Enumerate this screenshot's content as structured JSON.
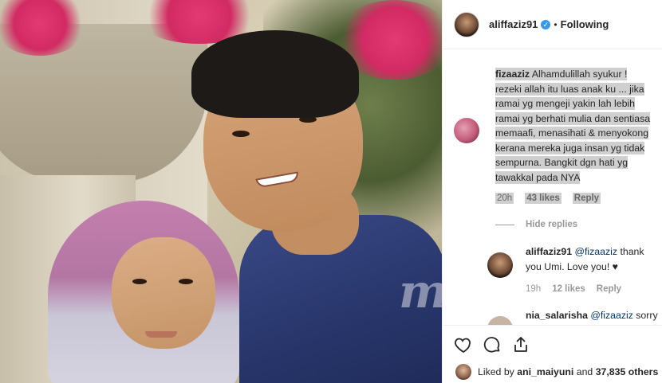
{
  "post": {
    "username": "aliffaziz91",
    "verified_icon": "verified-badge-icon",
    "separator": "•",
    "follow_status": "Following",
    "watermark": "mStar"
  },
  "comments": [
    {
      "username": "fizaaziz",
      "text": "Alhamdulillah syukur ! rezeki allah itu luas anak ku ... jika ramai yg mengeji yakin lah lebih ramai yg berhati mulia dan sentiasa memaafi, menasihati & menyokong kerana mereka juga insan yg tidak sempurna. Bangkit dgn hati yg tawakkal pada NYA",
      "time": "20h",
      "likes": "43 likes",
      "reply": "Reply",
      "hide_replies": "Hide replies",
      "replies": [
        {
          "username": "aliffaziz91",
          "mention": "@fizaaziz",
          "text": "thank you Umi. Love you! ♥",
          "time": "19h",
          "likes": "12 likes",
          "reply": "Reply"
        },
        {
          "username": "nia_salarisha",
          "mention": "@fizaaziz",
          "text": "sorry aunty but it just my"
        }
      ]
    }
  ],
  "footer": {
    "icons": [
      "heart-icon",
      "comment-icon",
      "share-icon"
    ],
    "liked_prefix": "Liked by",
    "liked_user": "ani_maiyuni",
    "liked_and": "and",
    "liked_count": "37,835 others"
  }
}
